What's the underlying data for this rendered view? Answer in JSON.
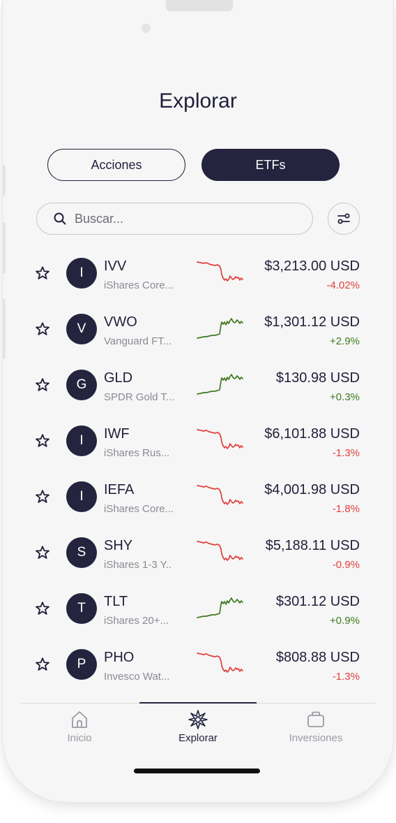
{
  "header": {
    "title": "Explorar"
  },
  "segments": {
    "acciones": "Acciones",
    "etfs": "ETFs",
    "active": "ETFs"
  },
  "search": {
    "placeholder": "Buscar...",
    "value": ""
  },
  "colors": {
    "primary": "#24243f",
    "negative": "#e0403d",
    "positive": "#3f7a1f",
    "background": "#f6f6f6"
  },
  "etfs": [
    {
      "initial": "I",
      "ticker": "IVV",
      "name": "iShares Core...",
      "price": "$3,213.00 USD",
      "change": "-4.02%",
      "trend": "down"
    },
    {
      "initial": "V",
      "ticker": "VWO",
      "name": "Vanguard FT...",
      "price": "$1,301.12 USD",
      "change": "+2.9%",
      "trend": "up"
    },
    {
      "initial": "G",
      "ticker": "GLD",
      "name": "SPDR Gold T...",
      "price": "$130.98 USD",
      "change": "+0.3%",
      "trend": "up"
    },
    {
      "initial": "I",
      "ticker": "IWF",
      "name": "iShares Rus...",
      "price": "$6,101.88 USD",
      "change": "-1.3%",
      "trend": "down"
    },
    {
      "initial": "I",
      "ticker": "IEFA",
      "name": "iShares Core...",
      "price": "$4,001.98 USD",
      "change": "-1.8%",
      "trend": "down"
    },
    {
      "initial": "S",
      "ticker": "SHY",
      "name": "iShares 1-3 Y..",
      "price": "$5,188.11 USD",
      "change": "-0.9%",
      "trend": "down"
    },
    {
      "initial": "T",
      "ticker": "TLT",
      "name": "iShares 20+...",
      "price": "$301.12 USD",
      "change": "+0.9%",
      "trend": "up"
    },
    {
      "initial": "P",
      "ticker": "PHO",
      "name": "Invesco Wat...",
      "price": "$808.88 USD",
      "change": "-1.3%",
      "trend": "down"
    }
  ],
  "nav": {
    "active": "Explorar",
    "items": [
      {
        "label": "Inicio",
        "icon": "home-icon"
      },
      {
        "label": "Explorar",
        "icon": "compass-icon"
      },
      {
        "label": "Inversiones",
        "icon": "briefcase-icon"
      }
    ]
  }
}
